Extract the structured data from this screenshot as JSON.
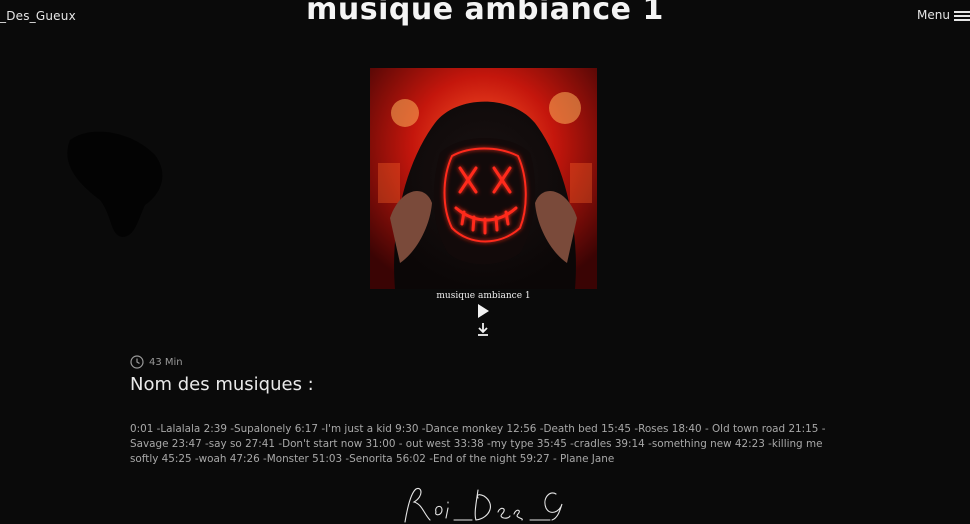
{
  "header": {
    "logo_text": "_Des_Gueux",
    "title": "musique ambiance 1",
    "menu_label": "Menu"
  },
  "player": {
    "track_caption": "musique ambiance 1",
    "play_icon": "play-icon",
    "download_icon": "download-icon"
  },
  "details": {
    "duration": "43 Min",
    "section_title": "Nom des musiques :",
    "tracklist": "0:01 -Lalalala 2:39 -Supalonely 6:17 -I'm just a kid 9:30 -Dance monkey 12:56 -Death bed 15:45 -Roses 18:40 - Old town road 21:15 -Savage 23:47 -say so 27:41 -Don't start now 31:00 - out west 33:38 -my type 35:45 -cradles 39:14 -something new 42:23 -killing me softly 45:25 -woah 47:26 -Monster 51:03 -Senorita 56:02 -End of the night 59:27 - Plane Jane"
  },
  "footer": {
    "signature_text": "Roi_Des_Gueux"
  },
  "colors": {
    "background": "#0a0a0a",
    "text": "#e8e8e8",
    "muted": "#a8a8a8",
    "accent_red": "#ff2a1a"
  }
}
